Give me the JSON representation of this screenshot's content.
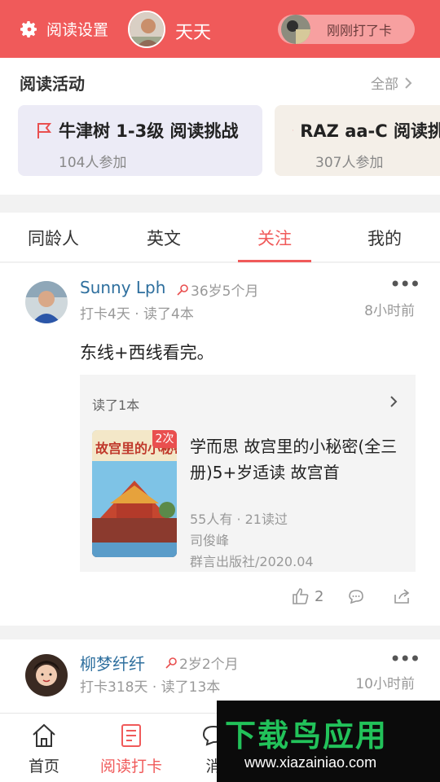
{
  "header": {
    "settings_label": "阅读设置",
    "username": "天天",
    "recent_checkin": "刚刚打了卡"
  },
  "activities": {
    "title": "阅读活动",
    "more_label": "全部",
    "cards": [
      {
        "title": "牛津树 1-3级 阅读挑战",
        "participants": "104人参加"
      },
      {
        "title": "RAZ aa-C 阅读挑战",
        "participants": "307人参加"
      }
    ]
  },
  "tabs": [
    {
      "label": "同龄人",
      "active": false
    },
    {
      "label": "英文",
      "active": false
    },
    {
      "label": "关注",
      "active": true
    },
    {
      "label": "我的",
      "active": false
    }
  ],
  "posts": [
    {
      "username": "Sunny Lph",
      "age": "36岁5个月",
      "meta": "打卡4天 · 读了4本",
      "time": "8小时前",
      "text": "东线+西线看完。",
      "books_read": "读了1本",
      "book": {
        "badge": "2次",
        "title": "学而思 故宫里的小秘密(全三册)5+岁适读 故宫首",
        "stats": "55人有 · 21读过",
        "author": "司俊峰",
        "publisher": "群言出版社/2020.04",
        "cover_text": "故宫里的小秘密"
      },
      "likes": "2"
    },
    {
      "username": "柳梦纤纤",
      "age": "2岁2个月",
      "meta": "打卡318天 · 读了13本",
      "time": "10小时前"
    }
  ],
  "bottom_nav": [
    {
      "label": "首页",
      "icon": "home-icon",
      "active": false
    },
    {
      "label": "阅读打卡",
      "icon": "checkin-icon",
      "active": true
    },
    {
      "label": "消",
      "icon": "message-icon",
      "active": false
    }
  ],
  "watermark": {
    "text": "下载鸟应用",
    "url": "www.xiazainiao.com"
  },
  "colors": {
    "brand": "#f05a5a",
    "username": "#2e6f9e",
    "watermark_green": "#22c25a"
  }
}
